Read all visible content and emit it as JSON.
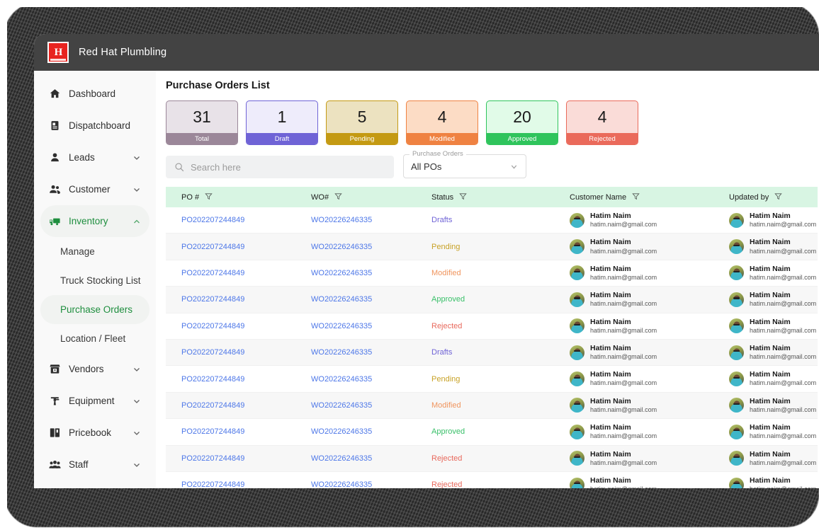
{
  "header": {
    "brand": "Red Hat Plumbling",
    "logo_letter": "H"
  },
  "sidebar": {
    "items": [
      {
        "label": "Dashboard",
        "icon": "home-icon",
        "expandable": false,
        "active": false
      },
      {
        "label": "Dispatchboard",
        "icon": "clipboard-icon",
        "expandable": false,
        "active": false
      },
      {
        "label": "Leads",
        "icon": "person-icon",
        "expandable": true,
        "active": false
      },
      {
        "label": "Customer",
        "icon": "people-icon",
        "expandable": true,
        "active": false
      },
      {
        "label": "Inventory",
        "icon": "truck-icon",
        "expandable": true,
        "active": true
      },
      {
        "label": "Vendors",
        "icon": "store-icon",
        "expandable": true,
        "active": false
      },
      {
        "label": "Equipment",
        "icon": "drill-icon",
        "expandable": true,
        "active": false
      },
      {
        "label": "Pricebook",
        "icon": "book-icon",
        "expandable": true,
        "active": false
      },
      {
        "label": "Staff",
        "icon": "group-icon",
        "expandable": true,
        "active": false
      }
    ],
    "inventory_subitems": [
      {
        "label": "Manage",
        "active": false
      },
      {
        "label": "Truck Stocking List",
        "active": false
      },
      {
        "label": "Purchase Orders",
        "active": true
      },
      {
        "label": "Location / Fleet",
        "active": false
      }
    ],
    "active_color": "#1e8e3e"
  },
  "main": {
    "page_title": "Purchase Orders List",
    "stats": [
      {
        "value": "31",
        "label": "Total",
        "body_bg": "#e8e2e8",
        "bar_bg": "#9b8799",
        "border": "#9b8799"
      },
      {
        "value": "1",
        "label": "Draft",
        "body_bg": "#eeecfb",
        "bar_bg": "#6f63d6",
        "border": "#6f63d6"
      },
      {
        "value": "5",
        "label": "Pending",
        "body_bg": "#ece2c0",
        "bar_bg": "#c49a13",
        "border": "#c49a13"
      },
      {
        "value": "4",
        "label": "Modified",
        "body_bg": "#fcdcc5",
        "bar_bg": "#ef8242",
        "border": "#ef8242"
      },
      {
        "value": "20",
        "label": "Approved",
        "body_bg": "#e1fbe8",
        "bar_bg": "#2fc45c",
        "border": "#2fc45c"
      },
      {
        "value": "4",
        "label": "Rejected",
        "body_bg": "#fadcd8",
        "bar_bg": "#ea6a5b",
        "border": "#ea6a5b"
      }
    ],
    "search": {
      "placeholder": "Search here",
      "value": ""
    },
    "select": {
      "legend": "Purchase Orders",
      "value": "All POs"
    },
    "table": {
      "columns": [
        "PO #",
        "WO#",
        "Status",
        "Customer Name",
        "Updated by"
      ],
      "header_bg": "#d8f5e3",
      "status_colors": {
        "Drafts": "#6f63d6",
        "Pending": "#c8a227",
        "Modified": "#f0955e",
        "Approved": "#3ac06a",
        "Rejected": "#e8695c"
      },
      "rows": [
        {
          "po": "PO202207244849",
          "wo": "WO20226246335",
          "status": "Drafts",
          "customer": {
            "name": "Hatim Naim",
            "email": "hatim.naim@gmail.com"
          },
          "updated_by": {
            "name": "Hatim Naim",
            "email": "hatim.naim@gmail.com"
          }
        },
        {
          "po": "PO202207244849",
          "wo": "WO20226246335",
          "status": "Pending",
          "customer": {
            "name": "Hatim Naim",
            "email": "hatim.naim@gmail.com"
          },
          "updated_by": {
            "name": "Hatim Naim",
            "email": "hatim.naim@gmail.com"
          }
        },
        {
          "po": "PO202207244849",
          "wo": "WO20226246335",
          "status": "Modified",
          "customer": {
            "name": "Hatim Naim",
            "email": "hatim.naim@gmail.com"
          },
          "updated_by": {
            "name": "Hatim Naim",
            "email": "hatim.naim@gmail.com"
          }
        },
        {
          "po": "PO202207244849",
          "wo": "WO20226246335",
          "status": "Approved",
          "customer": {
            "name": "Hatim Naim",
            "email": "hatim.naim@gmail.com"
          },
          "updated_by": {
            "name": "Hatim Naim",
            "email": "hatim.naim@gmail.com"
          }
        },
        {
          "po": "PO202207244849",
          "wo": "WO20226246335",
          "status": "Rejected",
          "customer": {
            "name": "Hatim Naim",
            "email": "hatim.naim@gmail.com"
          },
          "updated_by": {
            "name": "Hatim Naim",
            "email": "hatim.naim@gmail.com"
          }
        },
        {
          "po": "PO202207244849",
          "wo": "WO20226246335",
          "status": "Drafts",
          "customer": {
            "name": "Hatim Naim",
            "email": "hatim.naim@gmail.com"
          },
          "updated_by": {
            "name": "Hatim Naim",
            "email": "hatim.naim@gmail.com"
          }
        },
        {
          "po": "PO202207244849",
          "wo": "WO20226246335",
          "status": "Pending",
          "customer": {
            "name": "Hatim Naim",
            "email": "hatim.naim@gmail.com"
          },
          "updated_by": {
            "name": "Hatim Naim",
            "email": "hatim.naim@gmail.com"
          }
        },
        {
          "po": "PO202207244849",
          "wo": "WO20226246335",
          "status": "Modified",
          "customer": {
            "name": "Hatim Naim",
            "email": "hatim.naim@gmail.com"
          },
          "updated_by": {
            "name": "Hatim Naim",
            "email": "hatim.naim@gmail.com"
          }
        },
        {
          "po": "PO202207244849",
          "wo": "WO20226246335",
          "status": "Approved",
          "customer": {
            "name": "Hatim Naim",
            "email": "hatim.naim@gmail.com"
          },
          "updated_by": {
            "name": "Hatim Naim",
            "email": "hatim.naim@gmail.com"
          }
        },
        {
          "po": "PO202207244849",
          "wo": "WO20226246335",
          "status": "Rejected",
          "customer": {
            "name": "Hatim Naim",
            "email": "hatim.naim@gmail.com"
          },
          "updated_by": {
            "name": "Hatim Naim",
            "email": "hatim.naim@gmail.com"
          }
        },
        {
          "po": "PO202207244849",
          "wo": "WO20226246335",
          "status": "Rejected",
          "customer": {
            "name": "Hatim Naim",
            "email": "hatim.naim@gmail.com"
          },
          "updated_by": {
            "name": "Hatim Naim",
            "email": "hatim.naim@gmail.com"
          }
        }
      ]
    }
  }
}
